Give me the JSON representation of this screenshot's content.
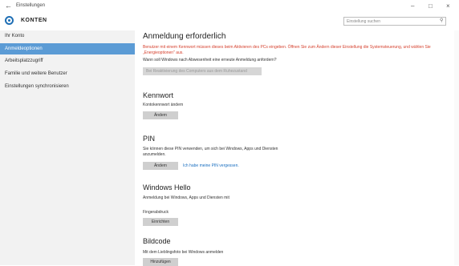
{
  "window": {
    "title": "Einstellungen",
    "back": "←",
    "minimize": "–",
    "maximize": "□",
    "close": "×"
  },
  "header": {
    "title": "KONTEN",
    "search_placeholder": "Einstellung suchen",
    "icon": "gear-icon"
  },
  "sidebar": {
    "items": [
      {
        "label": "Ihr Konto",
        "active": false
      },
      {
        "label": "Anmeldeoptionen",
        "active": true
      },
      {
        "label": "Arbeitsplatzzugriff",
        "active": false
      },
      {
        "label": "Familie und weitere Benutzer",
        "active": false
      },
      {
        "label": "Einstellungen synchronisieren",
        "active": false
      }
    ]
  },
  "main": {
    "section_login": {
      "title": "Anmeldung erforderlich",
      "warning": "Benutzer mit einem Kennwort müssen dieses beim Aktivieren des PCs eingeben. Öffnen Sie zum Ändern dieser Einstellung die Systemsteuerung, und wählen Sie „Energieoptionen\" aus.",
      "question": "Wann soll Windows nach Abwesenheit eine erneute Anmeldung anfordern?",
      "dropdown_value": "Bei Reaktivierung des Computers aus dem Ruhezustand"
    },
    "section_password": {
      "title": "Kennwort",
      "subtitle": "Kontokennwort ändern",
      "button": "Ändern"
    },
    "section_pin": {
      "title": "PIN",
      "desc": "Sie können diese PIN verwenden, um sich bei Windows, Apps und Diensten anzumelden.",
      "button": "Ändern",
      "link": "Ich habe meine PIN vergessen."
    },
    "section_hello": {
      "title": "Windows Hello",
      "desc": "Anmeldung bei Windows, Apps und Diensten mit",
      "sub": "Fingerabdruck",
      "button": "Einrichten"
    },
    "section_picture": {
      "title": "Bildcode",
      "desc": "Mit dem Lieblingsfoto bei Windows anmelden",
      "button": "Hinzufügen"
    }
  }
}
